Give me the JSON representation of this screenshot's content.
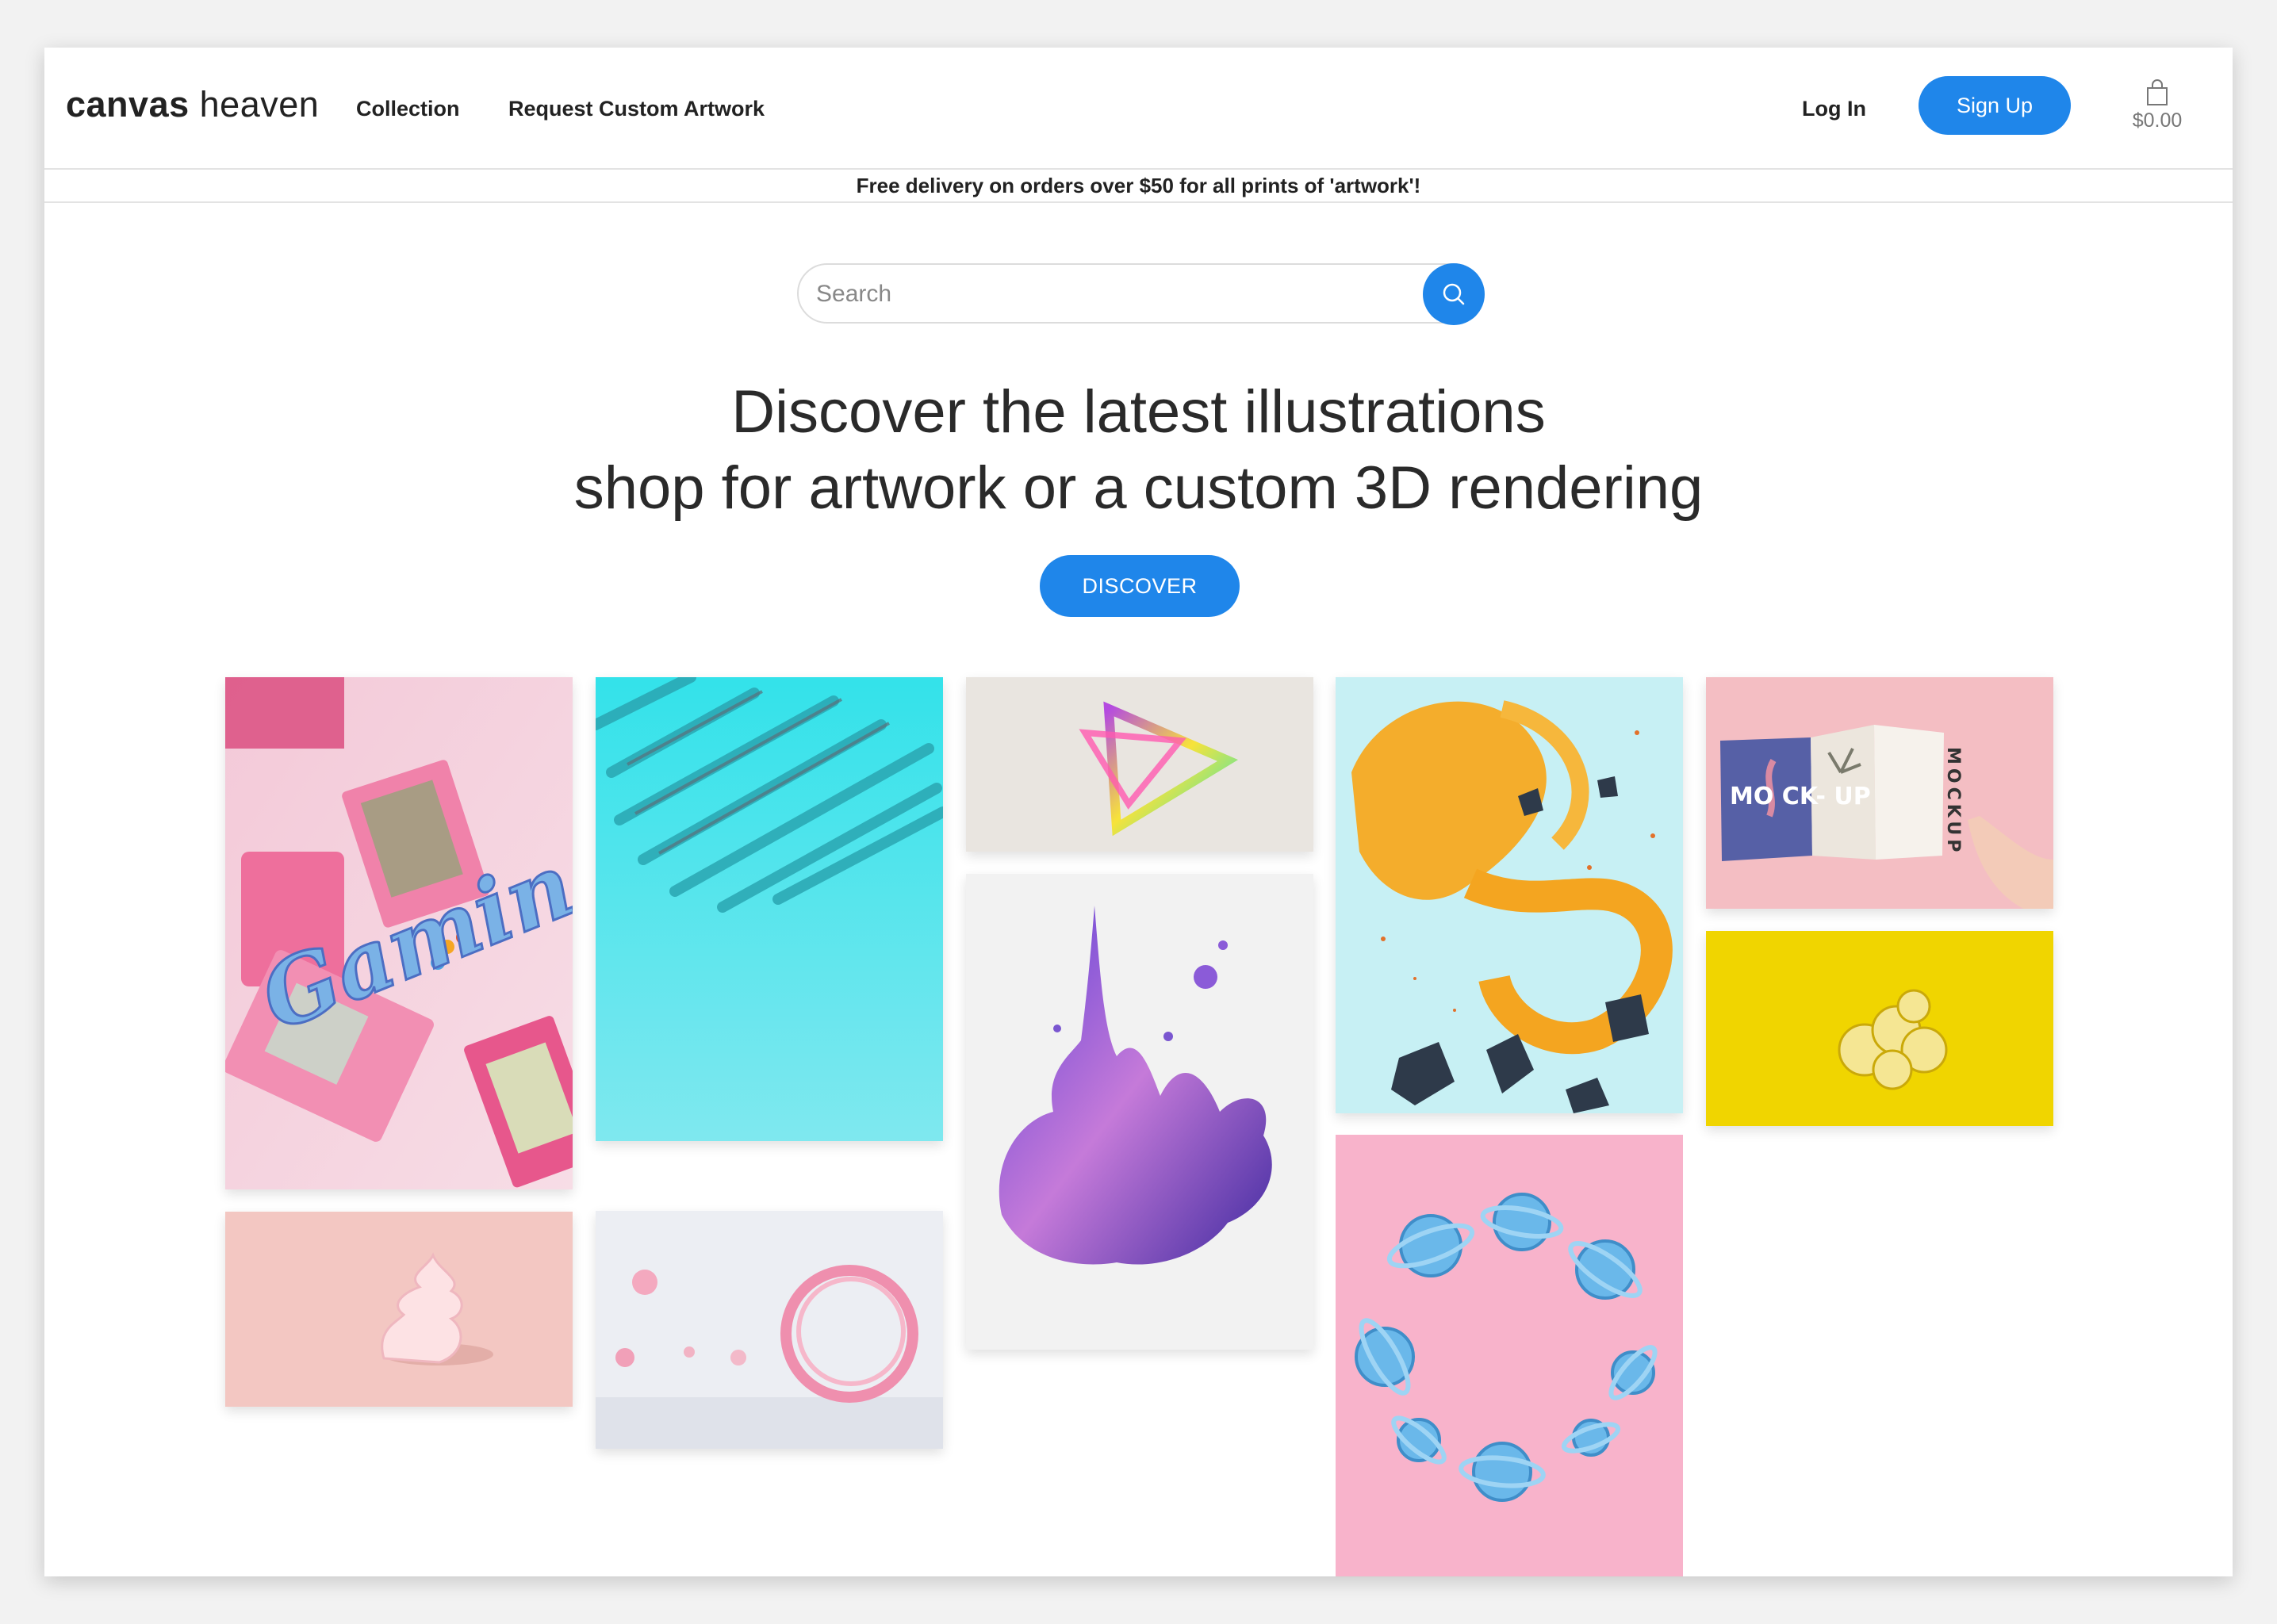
{
  "header": {
    "logo_bold": "canvas",
    "logo_light": "heaven",
    "nav": [
      "Collection",
      "Request Custom Artwork"
    ],
    "login_label": "Log In",
    "signup_label": "Sign Up",
    "cart_total": "$0.00"
  },
  "banner": {
    "text": "Free delivery on orders over $50 for all prints of 'artwork'!"
  },
  "search": {
    "placeholder": "Search"
  },
  "hero": {
    "line1": "Discover the latest illustrations",
    "line2": "shop for artwork or a custom 3D rendering",
    "cta_label": "DISCOVER"
  },
  "gallery": {
    "gaming_text": "Gaming",
    "mockup_cover_text": "MO CK- UP",
    "mockup_spine_text": "MOCKUP"
  },
  "colors": {
    "accent": "#1f86ea"
  }
}
